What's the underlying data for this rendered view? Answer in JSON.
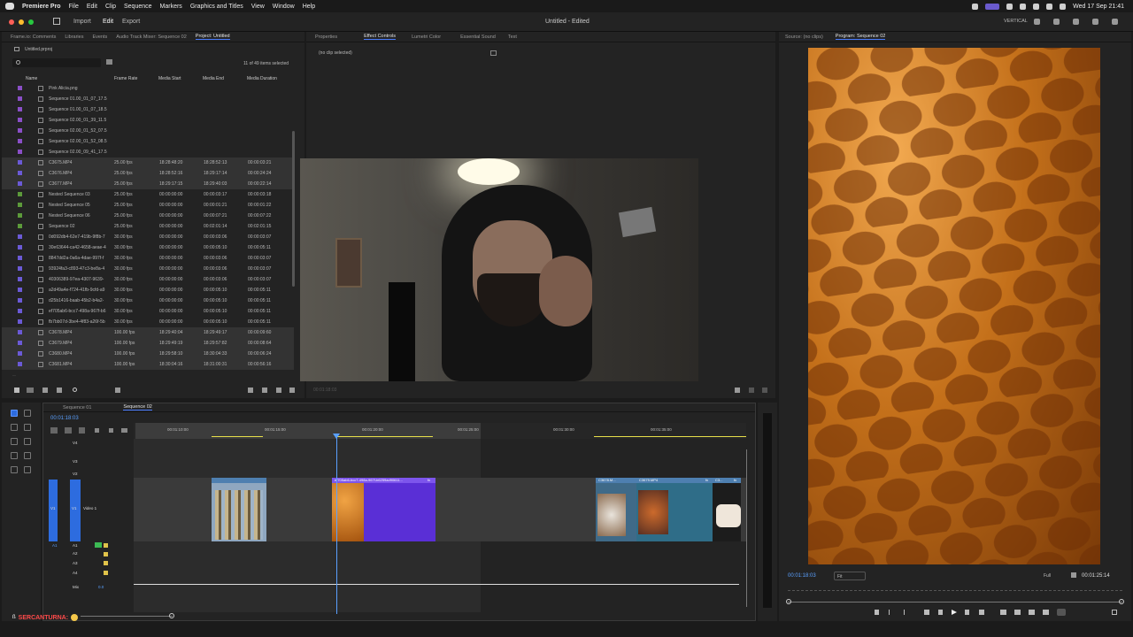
{
  "menubar": {
    "app": "Premiere Pro",
    "items": [
      "File",
      "Edit",
      "Clip",
      "Sequence",
      "Markers",
      "Graphics and Titles",
      "View",
      "Window",
      "Help"
    ],
    "clock": "Wed 17 Sep  21:41"
  },
  "titlebar": {
    "tabs": [
      "Import",
      "Edit",
      "Export"
    ],
    "active_tab": "Edit",
    "title": "Untitled - Edited",
    "vertical": "VERTICAL"
  },
  "project": {
    "tabs": [
      "Frame.io: Comments",
      "Libraries",
      "Events",
      "Audio Track Mixer: Sequence 02",
      "Project: Untitled"
    ],
    "active_tab": "Project: Untitled",
    "path": "Untitled.prproj",
    "items_selected": "11 of 49 items selected",
    "columns": [
      "Name",
      "Frame Rate",
      "Media Start",
      "Media End",
      "Media Duration"
    ],
    "rows": [
      {
        "name": "Pink Alicia.png",
        "color": "#8a4fc7",
        "rate": "",
        "start": "",
        "end": "",
        "dur": "",
        "sel": false
      },
      {
        "name": "Sequence 01.00_01_07_17.5",
        "color": "#8a4fc7",
        "rate": "",
        "start": "",
        "end": "",
        "dur": "",
        "sel": false
      },
      {
        "name": "Sequence 01.00_01_07_18.5",
        "color": "#8a4fc7",
        "rate": "",
        "start": "",
        "end": "",
        "dur": "",
        "sel": false
      },
      {
        "name": "Sequence 02.00_01_39_11.5",
        "color": "#8a4fc7",
        "rate": "",
        "start": "",
        "end": "",
        "dur": "",
        "sel": false
      },
      {
        "name": "Sequence 02.00_01_52_07.5",
        "color": "#8a4fc7",
        "rate": "",
        "start": "",
        "end": "",
        "dur": "",
        "sel": false
      },
      {
        "name": "Sequence 02.00_01_52_08.5",
        "color": "#8a4fc7",
        "rate": "",
        "start": "",
        "end": "",
        "dur": "",
        "sel": false
      },
      {
        "name": "Sequence 02.00_09_41_17.5",
        "color": "#8a4fc7",
        "rate": "",
        "start": "",
        "end": "",
        "dur": "",
        "sel": false
      },
      {
        "name": "C3675.MP4",
        "color": "#6b5ad6",
        "rate": "25.00 fps",
        "start": "18:28:48:20",
        "end": "18:28:52:13",
        "dur": "00:00:03:21",
        "sel": true
      },
      {
        "name": "C3676.MP4",
        "color": "#6b5ad6",
        "rate": "25.00 fps",
        "start": "18:28:52:16",
        "end": "18:29:17:14",
        "dur": "00:00:24:24",
        "sel": true
      },
      {
        "name": "C3677.MP4",
        "color": "#6b5ad6",
        "rate": "25.00 fps",
        "start": "18:29:17:15",
        "end": "18:29:40:03",
        "dur": "00:00:22:14",
        "sel": true
      },
      {
        "name": "Nested Sequence 03",
        "color": "#5c9a3a",
        "rate": "25.00 fps",
        "start": "00:00:00:00",
        "end": "00:00:03:17",
        "dur": "00:00:03:18",
        "sel": false
      },
      {
        "name": "Nested Sequence 05",
        "color": "#5c9a3a",
        "rate": "25.00 fps",
        "start": "00:00:00:00",
        "end": "00:00:01:21",
        "dur": "00:00:01:22",
        "sel": false
      },
      {
        "name": "Nested Sequence 06",
        "color": "#5c9a3a",
        "rate": "25.00 fps",
        "start": "00:00:00:00",
        "end": "00:00:07:21",
        "dur": "00:00:07:22",
        "sel": false
      },
      {
        "name": "Sequence 02",
        "color": "#5c9a3a",
        "rate": "25.00 fps",
        "start": "00:00:00:00",
        "end": "00:02:01:14",
        "dur": "00:02:01:15",
        "sel": false
      },
      {
        "name": "0d092db4-62e7-419b-9f8b-7",
        "color": "#6b5ad6",
        "rate": "30.00 fps",
        "start": "00:00:00:00",
        "end": "00:00:03:06",
        "dur": "00:00:03:07",
        "sel": false
      },
      {
        "name": "30e63644-ca42-4658-aeae-4",
        "color": "#6b5ad6",
        "rate": "30.00 fps",
        "start": "00:00:00:00",
        "end": "00:00:05:10",
        "dur": "00:00:05:11",
        "sel": false
      },
      {
        "name": "8847dd2a-0a6a-4dae-997f-f",
        "color": "#6b5ad6",
        "rate": "30.00 fps",
        "start": "00:00:00:00",
        "end": "00:00:03:06",
        "dur": "00:00:03:07",
        "sel": false
      },
      {
        "name": "93924fa3-c893-47c3-be8a-4",
        "color": "#6b5ad6",
        "rate": "30.00 fps",
        "start": "00:00:00:00",
        "end": "00:00:03:06",
        "dur": "00:00:03:07",
        "sel": false
      },
      {
        "name": "40306389-97ea-4307-9639-",
        "color": "#6b5ad6",
        "rate": "30.00 fps",
        "start": "00:00:00:00",
        "end": "00:00:03:06",
        "dur": "00:00:03:07",
        "sel": false
      },
      {
        "name": "a2d49a4e-f724-41fb-9cfd-a9",
        "color": "#6b5ad6",
        "rate": "30.00 fps",
        "start": "00:00:00:00",
        "end": "00:00:05:10",
        "dur": "00:00:05:11",
        "sel": false
      },
      {
        "name": "d25b1416-baab-45b2-b4a2-",
        "color": "#6b5ad6",
        "rate": "30.00 fps",
        "start": "00:00:00:00",
        "end": "00:00:05:10",
        "dur": "00:00:05:11",
        "sel": false
      },
      {
        "name": "ef705ab6-bcc7-498a-967f-b6",
        "color": "#6b5ad6",
        "rate": "30.00 fps",
        "start": "00:00:00:00",
        "end": "00:00:05:10",
        "dur": "00:00:05:11",
        "sel": false
      },
      {
        "name": "fb7bb07d-3be4-4f83-a26f-5b",
        "color": "#6b5ad6",
        "rate": "30.00 fps",
        "start": "00:00:00:00",
        "end": "00:00:05:10",
        "dur": "00:00:05:11",
        "sel": false
      },
      {
        "name": "C3678.MP4",
        "color": "#6b5ad6",
        "rate": "100.00 fps",
        "start": "18:29:40:04",
        "end": "18:29:49:17",
        "dur": "00:00:09:60",
        "sel": true
      },
      {
        "name": "C3679.MP4",
        "color": "#6b5ad6",
        "rate": "100.00 fps",
        "start": "18:29:49:19",
        "end": "18:29:57:82",
        "dur": "00:00:08:64",
        "sel": true
      },
      {
        "name": "C3680.MP4",
        "color": "#6b5ad6",
        "rate": "100.00 fps",
        "start": "18:29:58:10",
        "end": "18:30:04:33",
        "dur": "00:00:06:24",
        "sel": true
      },
      {
        "name": "C3681.MP4",
        "color": "#6b5ad6",
        "rate": "100.00 fps",
        "start": "18:30:04:16",
        "end": "18:31:00:31",
        "dur": "00:00:56:16",
        "sel": true
      }
    ]
  },
  "effects": {
    "tabs": [
      "Properties",
      "Effect Controls",
      "Lumetri Color",
      "Essential Sound",
      "Text"
    ],
    "active_tab": "Effect Controls",
    "empty": "(no clip selected)",
    "timecode": "00:01:18:03"
  },
  "program": {
    "tabs": [
      "Source: (no clips)",
      "Program: Sequence 02"
    ],
    "active_tab": "Program: Sequence 02",
    "timecode": "00:01:18:03",
    "fit": "Fit",
    "quality": "Full",
    "duration": "00:01:25:14"
  },
  "timeline": {
    "tabs": [
      "Sequence 01",
      "Sequence 02"
    ],
    "active_tab": "Sequence 02",
    "timecode": "00:01:18:03",
    "ruler": [
      "00:01:10:00",
      "00:01:15:00",
      "00:01:20:00",
      "00:01:25:00",
      "00:01:30:00",
      "00:01:35:00"
    ],
    "tracks": {
      "video": [
        "V4",
        "V3",
        "V2",
        "V1"
      ],
      "v1_name": "Video 1",
      "audio": [
        "A1",
        "A2",
        "A3",
        "A4"
      ],
      "mix": "Mix",
      "mix_val": "0.0"
    },
    "clips": [
      {
        "label": "ef705ab6-bcc7-498a-967f-b6259ad90611...",
        "fx": "fx"
      },
      {
        "label": "C3678.M...",
        "fx": ""
      },
      {
        "label": "C3679.MP4",
        "fx": "fx"
      },
      {
        "label": "C3...",
        "fx": "fx"
      }
    ]
  },
  "watermark": "SERCANTURNA:"
}
